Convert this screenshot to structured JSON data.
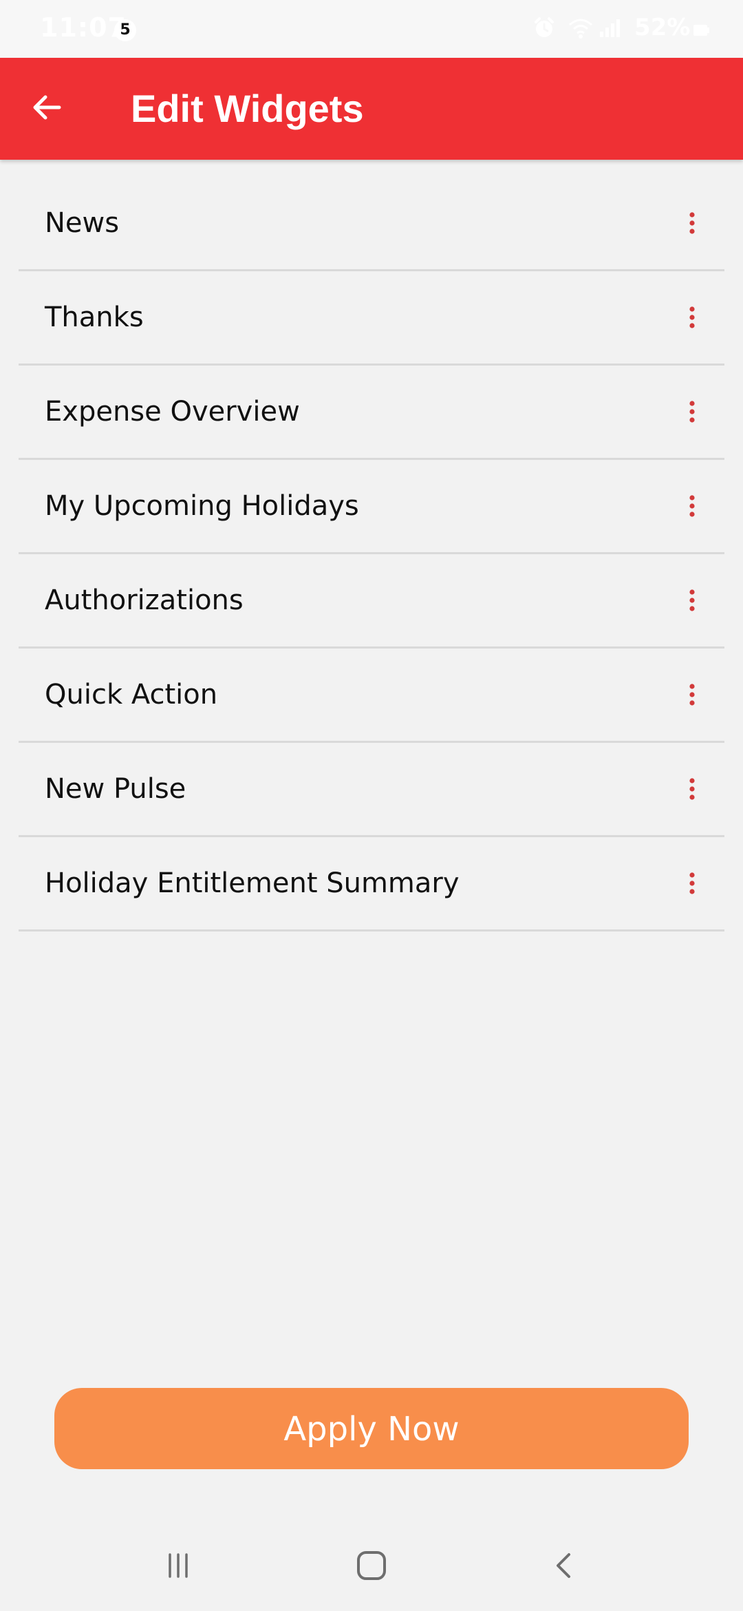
{
  "status_bar": {
    "time": "11:07",
    "notification_count": "5",
    "battery": "52%",
    "icons": [
      "alarm-icon",
      "wifi-icon",
      "signal-icon",
      "battery-icon"
    ]
  },
  "app_bar": {
    "title": "Edit Widgets",
    "back_icon": "arrow-left-icon",
    "background_color": "#ef3034"
  },
  "widgets": [
    {
      "label": "News",
      "handle_icon": "drag-dots-icon"
    },
    {
      "label": "Thanks",
      "handle_icon": "drag-dots-icon"
    },
    {
      "label": "Expense Overview",
      "handle_icon": "drag-dots-icon"
    },
    {
      "label": "My Upcoming Holidays",
      "handle_icon": "drag-dots-icon"
    },
    {
      "label": "Authorizations",
      "handle_icon": "drag-dots-icon"
    },
    {
      "label": "Quick Action",
      "handle_icon": "drag-dots-icon"
    },
    {
      "label": "New Pulse",
      "handle_icon": "drag-dots-icon"
    },
    {
      "label": "Holiday Entitlement Summary",
      "handle_icon": "drag-dots-icon"
    }
  ],
  "apply_button": {
    "label": "Apply Now",
    "color": "#f88e4b"
  },
  "nav_bar": {
    "icons": [
      "recent-apps-icon",
      "home-icon",
      "back-icon"
    ]
  },
  "colors": {
    "accent": "#ef3034",
    "handle": "#d23a3a",
    "background": "#f2f2f2"
  }
}
